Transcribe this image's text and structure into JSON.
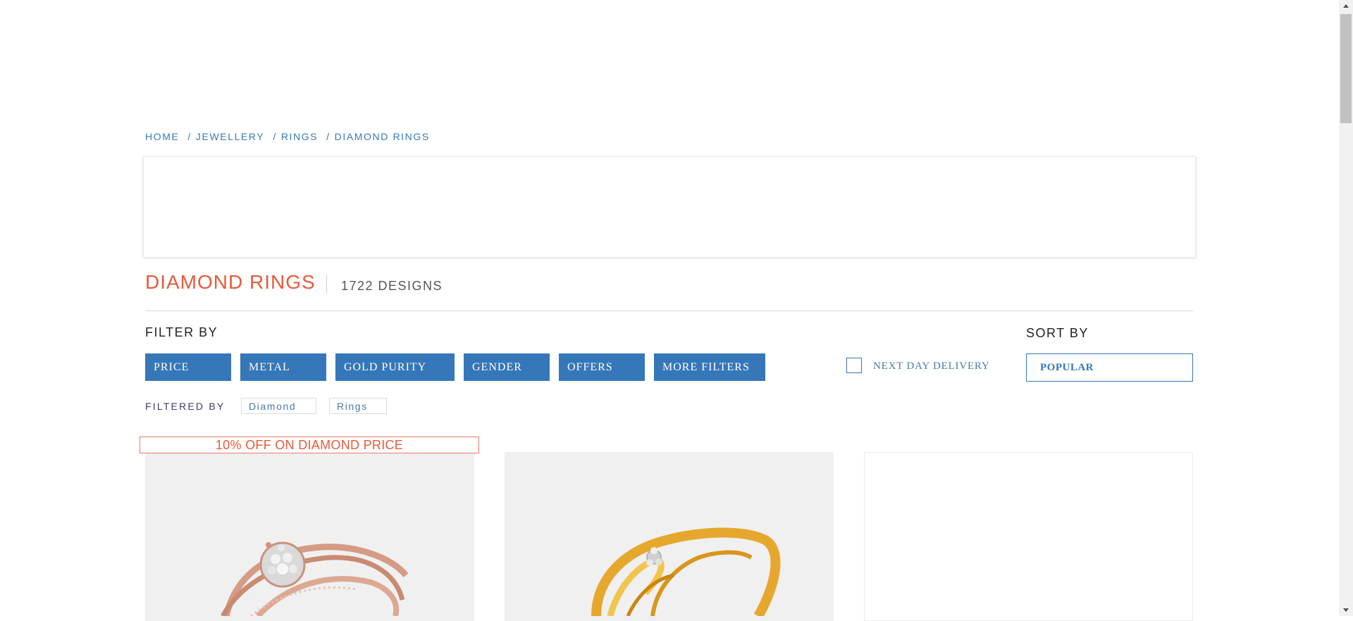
{
  "breadcrumb": {
    "items": [
      "HOME",
      "JEWELLERY",
      "RINGS",
      "DIAMOND RINGS"
    ],
    "separator": "/"
  },
  "heading": {
    "title": "DIAMOND RINGS",
    "count": "1722 DESIGNS"
  },
  "filters": {
    "heading": "FILTER BY",
    "chips": [
      "PRICE",
      "METAL",
      "GOLD PURITY",
      "GENDER",
      "OFFERS",
      "MORE FILTERS"
    ],
    "next_day_delivery": "NEXT DAY DELIVERY",
    "next_day_delivery_checked": false
  },
  "sort": {
    "heading": "SORT BY",
    "selected": "POPULAR"
  },
  "filtered": {
    "label": "FILTERED BY",
    "tags": [
      "Diamond",
      "Rings"
    ]
  },
  "offer": {
    "text": "10% OFF ON DIAMOND PRICE"
  },
  "colors": {
    "accent": "#3577b8",
    "title": "#e85a3c",
    "link": "#3a78b5"
  }
}
